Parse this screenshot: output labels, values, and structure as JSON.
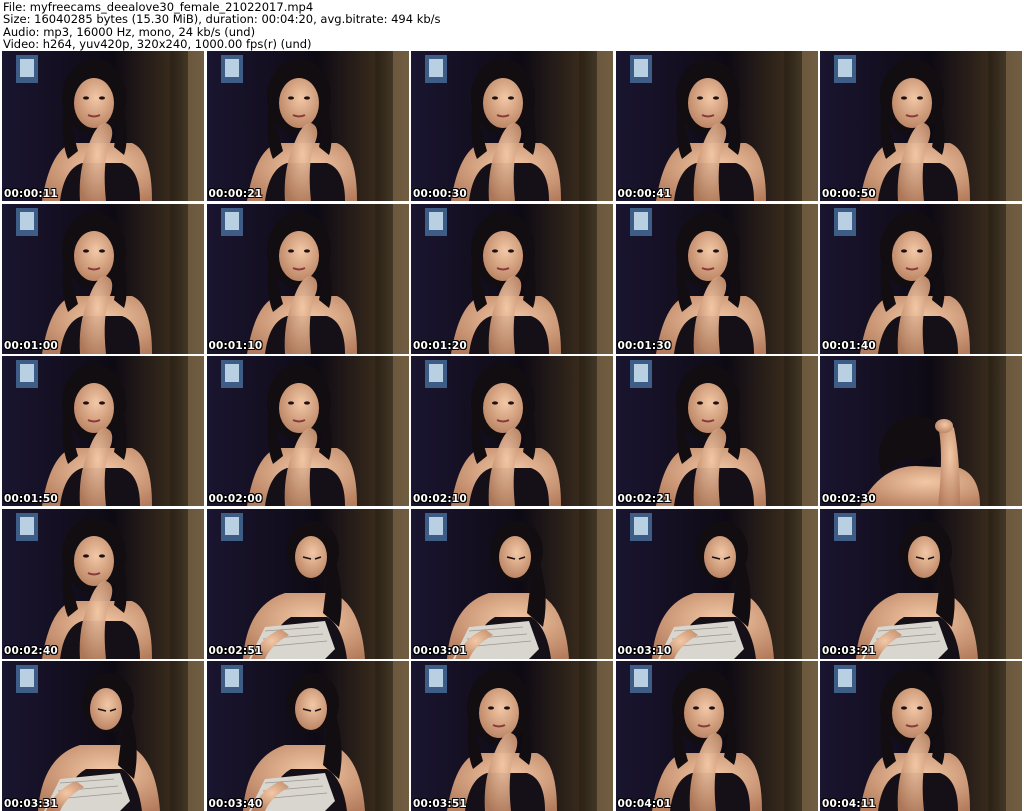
{
  "header": {
    "file_line": "File: myfreecams_deealove30_female_21022017.mp4",
    "size_line": "Size: 16040285 bytes (15.30 MiB), duration: 00:04:20, avg.bitrate: 494 kb/s",
    "audio_line": "Audio: mp3, 16000 Hz, mono, 24 kb/s (und)",
    "video_line": "Video: h264, yuv420p, 320x240, 1000.00 fps(r) (und)"
  },
  "frames": [
    {
      "timestamp": "00:00:11",
      "pose": "hand-chin"
    },
    {
      "timestamp": "00:00:21",
      "pose": "hand-chin"
    },
    {
      "timestamp": "00:00:30",
      "pose": "hand-chin"
    },
    {
      "timestamp": "00:00:41",
      "pose": "hand-chin"
    },
    {
      "timestamp": "00:00:50",
      "pose": "hand-chin"
    },
    {
      "timestamp": "00:01:00",
      "pose": "hand-chin"
    },
    {
      "timestamp": "00:01:10",
      "pose": "hand-chin"
    },
    {
      "timestamp": "00:01:20",
      "pose": "hand-chin"
    },
    {
      "timestamp": "00:01:30",
      "pose": "hand-chin"
    },
    {
      "timestamp": "00:01:40",
      "pose": "hand-chin"
    },
    {
      "timestamp": "00:01:50",
      "pose": "hand-chin"
    },
    {
      "timestamp": "00:02:00",
      "pose": "hand-chin"
    },
    {
      "timestamp": "00:02:10",
      "pose": "hand-chin"
    },
    {
      "timestamp": "00:02:21",
      "pose": "hand-chin"
    },
    {
      "timestamp": "00:02:30",
      "pose": "head-down"
    },
    {
      "timestamp": "00:02:40",
      "pose": "hand-chin"
    },
    {
      "timestamp": "00:02:51",
      "pose": "reading"
    },
    {
      "timestamp": "00:03:01",
      "pose": "reading"
    },
    {
      "timestamp": "00:03:10",
      "pose": "reading"
    },
    {
      "timestamp": "00:03:21",
      "pose": "reading"
    },
    {
      "timestamp": "00:03:31",
      "pose": "reading"
    },
    {
      "timestamp": "00:03:40",
      "pose": "reading"
    },
    {
      "timestamp": "00:03:51",
      "pose": "leaning"
    },
    {
      "timestamp": "00:04:01",
      "pose": "leaning"
    },
    {
      "timestamp": "00:04:11",
      "pose": "hand-chin"
    }
  ],
  "colors": {
    "background": "#ffffff",
    "header_text": "#000000",
    "timestamp_text": "#ffffff",
    "scene_dark": "#0a0810",
    "skin": "#e8b896",
    "hair": "#120d10",
    "window_light": "#cfe4f2",
    "door_light": "#c8b38a"
  }
}
